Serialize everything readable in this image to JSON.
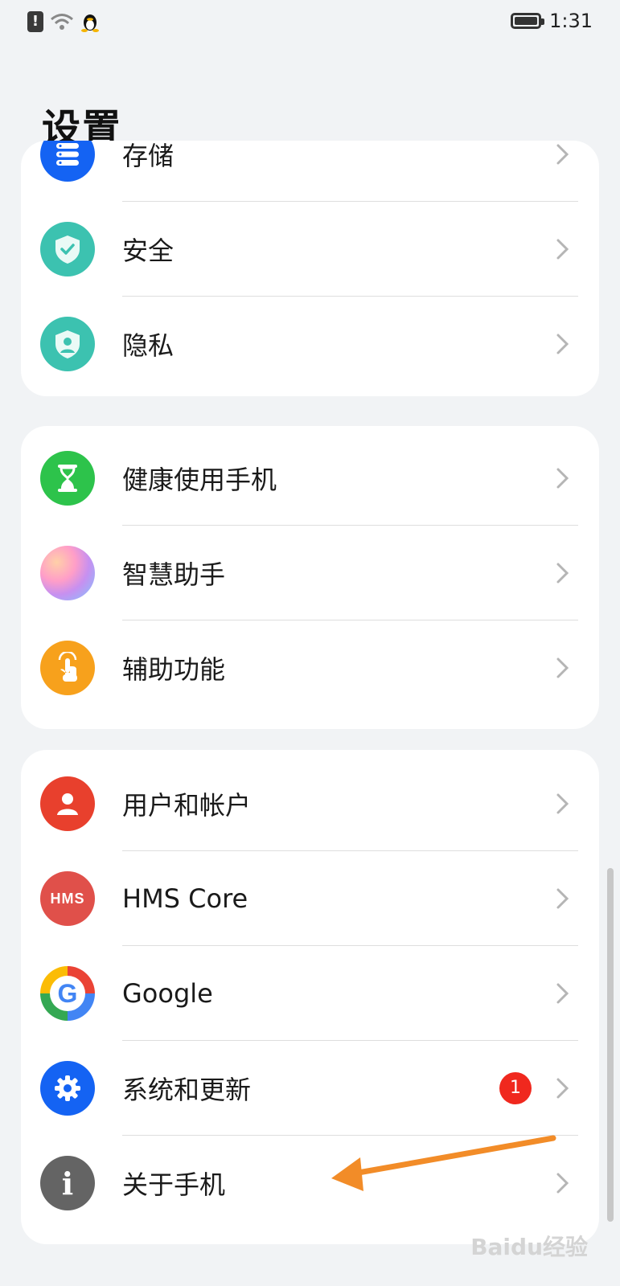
{
  "status_bar": {
    "time": "1:31"
  },
  "page": {
    "title": "设置"
  },
  "groups": [
    {
      "items": [
        {
          "label": "存储",
          "icon": "storage-icon",
          "color": "#1463f3"
        },
        {
          "label": "安全",
          "icon": "shield-check-icon",
          "color": "#3cc2b0"
        },
        {
          "label": "隐私",
          "icon": "privacy-shield-icon",
          "color": "#3cc2b0"
        }
      ]
    },
    {
      "items": [
        {
          "label": "健康使用手机",
          "icon": "hourglass-icon",
          "color": "#2dc34b"
        },
        {
          "label": "智慧助手",
          "icon": "assistant-orb-icon",
          "color": "#c790f0"
        },
        {
          "label": "辅助功能",
          "icon": "hand-touch-icon",
          "color": "#f7a11c"
        }
      ]
    },
    {
      "items": [
        {
          "label": "用户和帐户",
          "icon": "user-icon",
          "color": "#e8402d"
        },
        {
          "label": "HMS Core",
          "icon": "hms-icon",
          "icon_text": "HMS",
          "color": "#e0504a"
        },
        {
          "label": "Google",
          "icon": "google-icon",
          "icon_text": "G",
          "color": "#ffffff"
        },
        {
          "label": "系统和更新",
          "icon": "gear-icon",
          "color": "#1463f3",
          "badge": "1"
        },
        {
          "label": "关于手机",
          "icon": "info-icon",
          "icon_text": "i",
          "color": "#646464"
        }
      ]
    }
  ],
  "watermark": "Baidu经验"
}
